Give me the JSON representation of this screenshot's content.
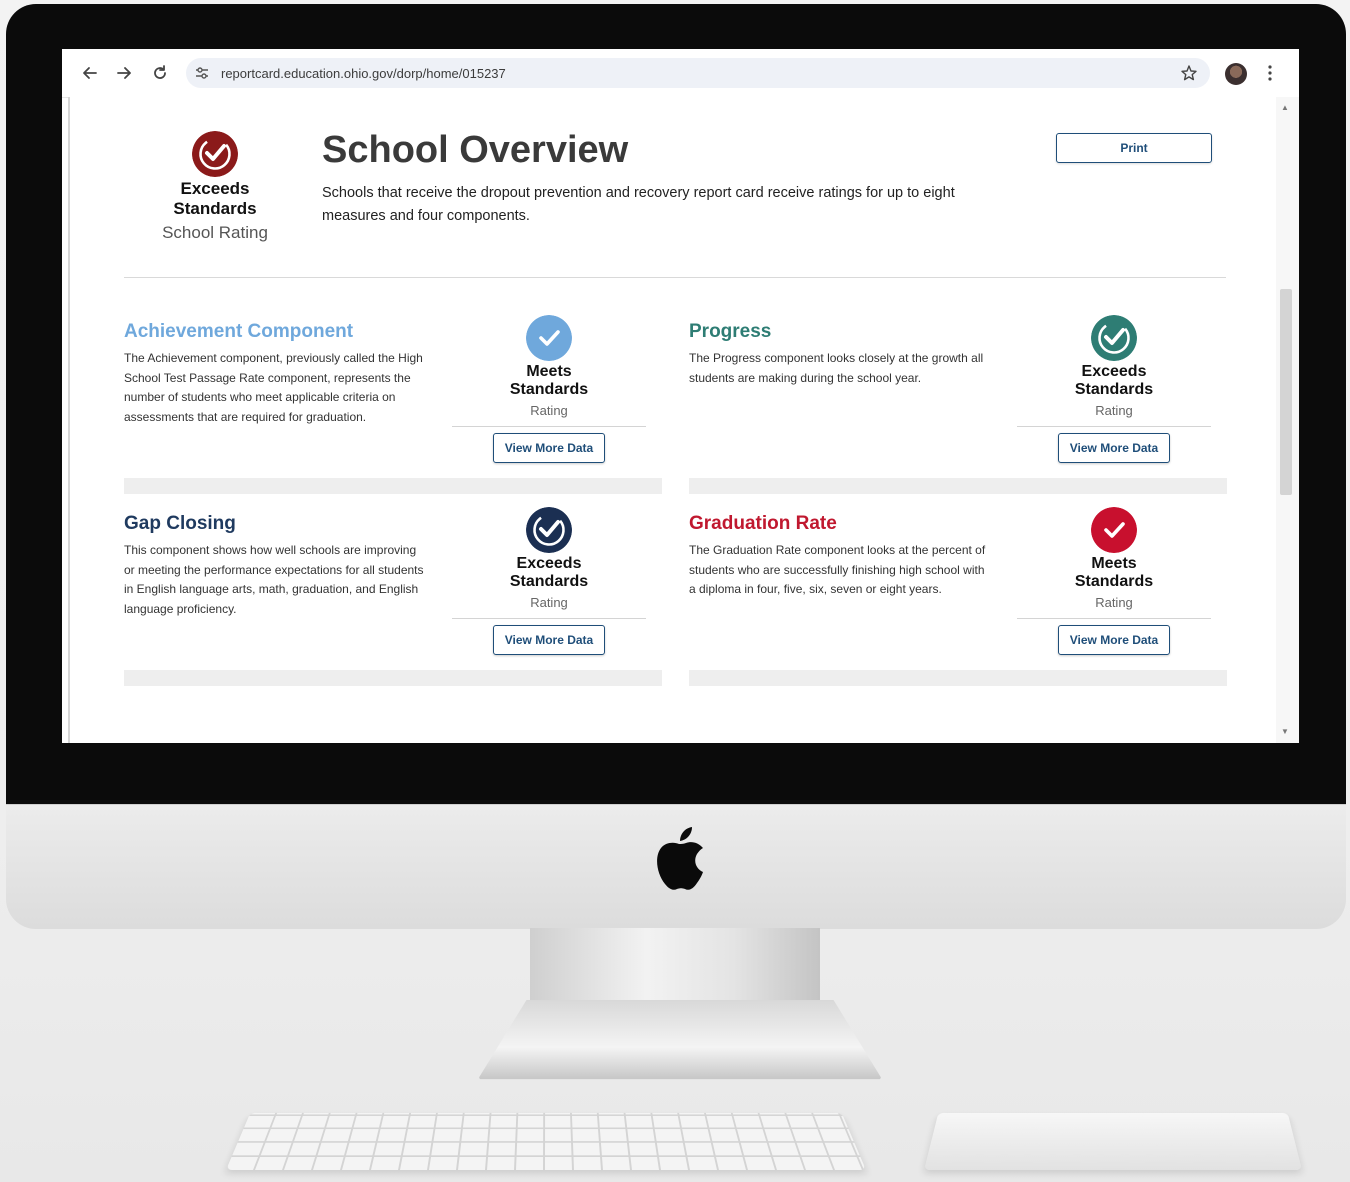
{
  "browser": {
    "url": "reportcard.education.ohio.gov/dorp/home/015237"
  },
  "overview": {
    "rating_line1": "Exceeds",
    "rating_line2": "Standards",
    "rating_sub": "School Rating",
    "rating_color": "#8b1a1a",
    "title": "School Overview",
    "description": "Schools that receive the dropout prevention and recovery report card receive ratings for up to eight measures and four components.",
    "print_label": "Print"
  },
  "components": [
    {
      "title": "Achievement Component",
      "title_color": "#6fa8dc",
      "description": "The Achievement component, previously called the High School Test Passage Rate component, represents the number of students who meet applicable criteria on assessments that are required for graduation.",
      "rating_line1": "Meets",
      "rating_line2": "Standards",
      "rating_sub": "Rating",
      "badge_color": "#6fa8dc",
      "button_label": "View More Data"
    },
    {
      "title": "Progress",
      "title_color": "#2e7d74",
      "description": "The Progress component looks closely at the growth all students are making during the school year.",
      "rating_line1": "Exceeds",
      "rating_line2": "Standards",
      "rating_sub": "Rating",
      "badge_color": "#2e7d74",
      "button_label": "View More Data"
    },
    {
      "title": "Gap Closing",
      "title_color": "#1f3a5f",
      "description": "This component shows how well schools are improving or meeting the performance expectations for all students in English language arts, math, graduation, and English language proficiency.",
      "rating_line1": "Exceeds",
      "rating_line2": "Standards",
      "rating_sub": "Rating",
      "badge_color": "#1b2f52",
      "button_label": "View More Data"
    },
    {
      "title": "Graduation Rate",
      "title_color": "#c0182f",
      "description": "The Graduation Rate component looks at the percent of students who are successfully finishing high school with a diploma in four, five, six, seven or eight years.",
      "rating_line1": "Meets",
      "rating_line2": "Standards",
      "rating_sub": "Rating",
      "badge_color": "#c8102e",
      "button_label": "View More Data"
    }
  ]
}
